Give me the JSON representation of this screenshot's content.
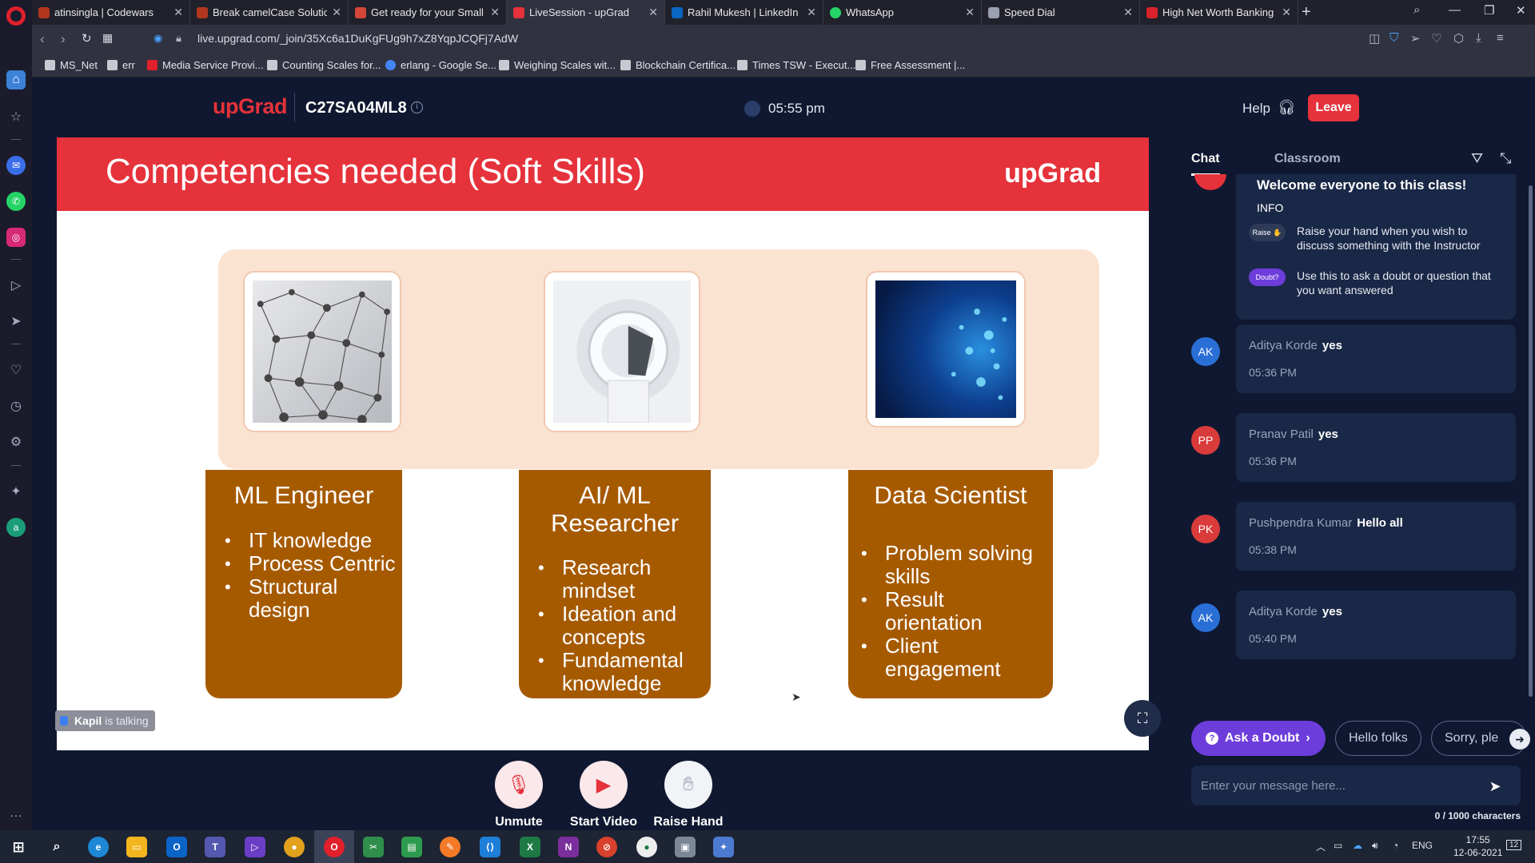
{
  "browser": {
    "tabs": [
      {
        "title": "atinsingla | Codewars",
        "fav": "#b1361e"
      },
      {
        "title": "Break camelCase Solutions",
        "fav": "#b1361e"
      },
      {
        "title": "Get ready for your Small G",
        "fav": "#d44638"
      },
      {
        "title": "LiveSession - upGrad",
        "fav": "#e5323b"
      },
      {
        "title": "Rahil Mukesh | LinkedIn",
        "fav": "#0a66c2"
      },
      {
        "title": "WhatsApp",
        "fav": "#25d366"
      },
      {
        "title": "Speed Dial",
        "fav": "#9aa0b0"
      },
      {
        "title": "High Net Worth Banking -",
        "fav": "#d8232a"
      }
    ],
    "active_tab": 3,
    "url": "live.upgrad.com/_join/35Xc6a1DuKgFUg9h7xZ8YqpJCQFj7AdW",
    "bookmarks": [
      "MS_Net",
      "err",
      "Media Service Provi...",
      "Counting Scales for...",
      "erlang - Google Se...",
      "Weighing Scales wit...",
      "Blockchain Certifica...",
      "Times TSW - Execut...",
      "Free Assessment |..."
    ]
  },
  "header": {
    "logo": "upGrad",
    "session_code": "C27SA04ML8",
    "time": "05:55 pm",
    "help_label": "Help",
    "leave_label": "Leave"
  },
  "slide": {
    "title": "Competencies needed (Soft Skills)",
    "logo": "upGrad",
    "roles": [
      {
        "title": "ML Engineer",
        "skills": [
          "IT knowledge",
          "Process Centric",
          "Structural design"
        ]
      },
      {
        "title": "AI/ ML Researcher",
        "skills": [
          "Research mindset",
          "Ideation and concepts",
          "Fundamental knowledge"
        ]
      },
      {
        "title": "Data Scientist",
        "skills": [
          "Problem solving skills",
          "Result orientation",
          "Client engagement"
        ]
      }
    ]
  },
  "speaker": {
    "name": "Kapil",
    "status": "is talking"
  },
  "controls": {
    "unmute": "Unmute",
    "start_video": "Start Video",
    "raise_hand": "Raise Hand"
  },
  "chat": {
    "tabs": [
      "Chat",
      "Classroom"
    ],
    "welcome_title": "Welcome everyone to this class!",
    "info_label": "INFO",
    "raise_pill": "Raise ✋",
    "raise_text": "Raise your hand when you wish to discuss something with the Instructor",
    "doubt_pill": "Doubt?",
    "doubt_text": "Use this to ask a doubt or question that you want answered",
    "messages": [
      {
        "initials": "AK",
        "name": "Aditya Korde",
        "text": "yes",
        "time": "05:36 PM",
        "color": "#2a6fd6"
      },
      {
        "initials": "PP",
        "name": "Pranav Patil",
        "text": "yes",
        "time": "05:36 PM",
        "color": "#d93b3b"
      },
      {
        "initials": "PK",
        "name": "Pushpendra Kumar",
        "text": "Hello all",
        "time": "05:38 PM",
        "color": "#d93b3b"
      },
      {
        "initials": "AK",
        "name": "Aditya Korde",
        "text": "yes",
        "time": "05:40 PM",
        "color": "#2a6fd6"
      }
    ],
    "ask_doubt": "Ask a Doubt",
    "quick_replies": [
      "Hello folks",
      "Sorry, ple"
    ],
    "input_placeholder": "Enter your message here...",
    "char_counter": "0 / 1000 characters"
  },
  "taskbar": {
    "lang": "ENG",
    "time": "17:55",
    "date": "12-06-2021",
    "notifications": "12"
  }
}
